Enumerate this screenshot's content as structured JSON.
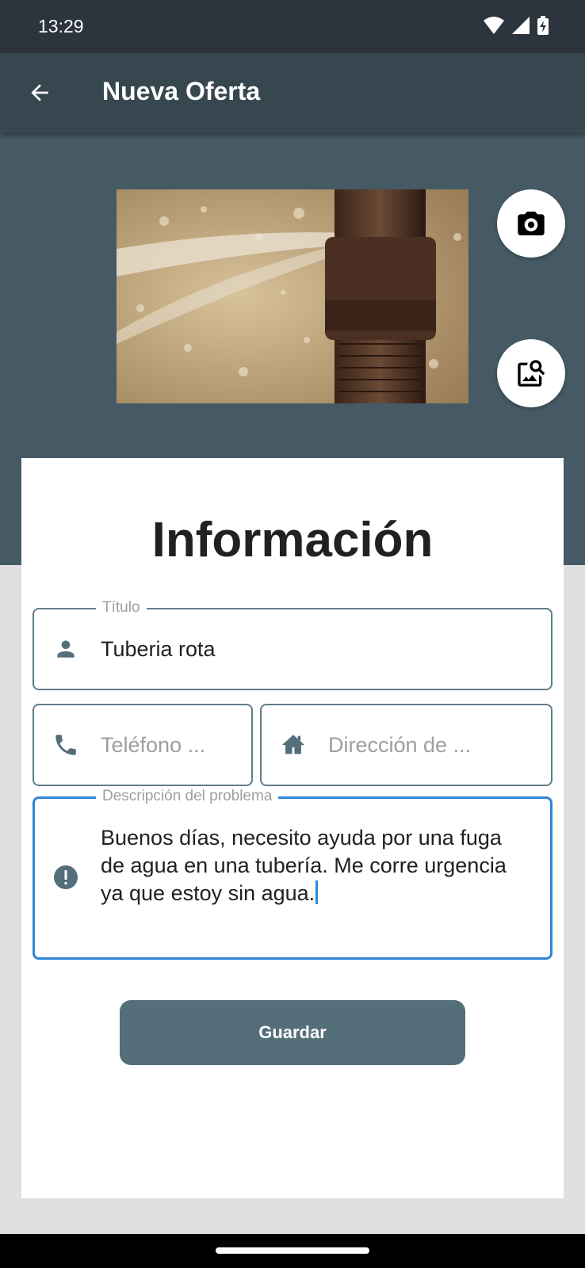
{
  "status_bar": {
    "time": "13:29",
    "icons": [
      "wifi-icon",
      "signal-icon",
      "battery-charging-icon"
    ]
  },
  "app_bar": {
    "title": "Nueva Oferta",
    "back_icon": "arrow-back-icon"
  },
  "photo": {
    "description": "burst-pipe-photo"
  },
  "actions": {
    "camera_icon": "camera-icon",
    "gallery_icon": "image-search-icon"
  },
  "form": {
    "heading": "Información",
    "title_field": {
      "label": "Título",
      "value": "Tuberia rota",
      "icon": "person-icon"
    },
    "phone_field": {
      "placeholder": "Teléfono ...",
      "icon": "phone-icon"
    },
    "address_field": {
      "placeholder": "Dirección de ...",
      "icon": "home-icon"
    },
    "description_field": {
      "label": "Descripción del problema",
      "value": "Buenos días, necesito ayuda por una fuga de agua en una tubería. Me corre urgencia ya que estoy sin agua.",
      "icon": "error-icon"
    },
    "save_label": "Guardar"
  },
  "colors": {
    "app_bar": "#37474f",
    "hero": "#455a64",
    "accent": "#2f86d6",
    "button": "#546e7a",
    "field_border": "#607d8b"
  }
}
